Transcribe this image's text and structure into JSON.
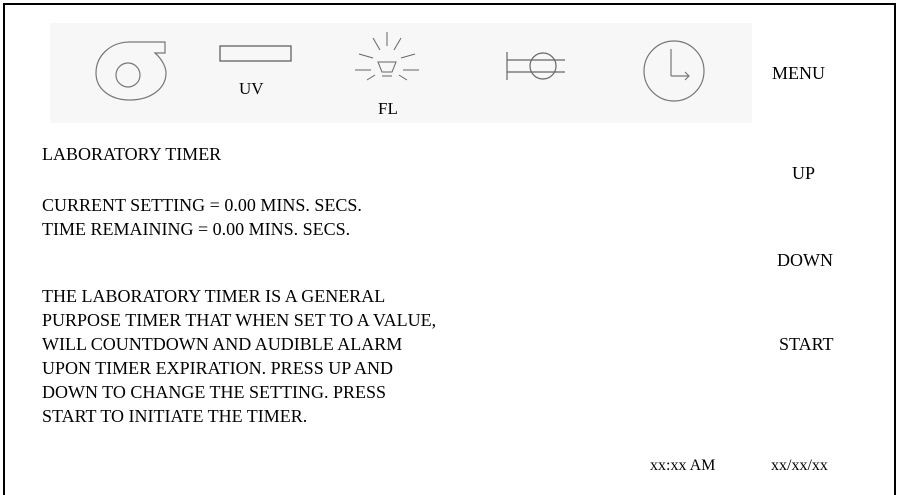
{
  "toolbar": {
    "icons": [
      {
        "name": "blower-fan-icon"
      },
      {
        "name": "uv-lamp-icon",
        "label": "UV"
      },
      {
        "name": "fluorescent-light-icon",
        "label": "FL"
      },
      {
        "name": "outlet-valve-icon"
      },
      {
        "name": "clock-timer-icon"
      }
    ],
    "menu_label": "MENU"
  },
  "screen": {
    "title": "LABORATORY TIMER",
    "current_setting": "CURRENT SETTING = 0.00 MINS. SECS.",
    "time_remaining": "TIME REMAINING = 0.00 MINS. SECS.",
    "description_lines": [
      "THE LABORATORY TIMER IS A GENERAL",
      "PURPOSE TIMER THAT WHEN SET TO A VALUE,",
      "WILL COUNTDOWN AND AUDIBLE ALARM",
      "UPON TIMER EXPIRATION.  PRESS UP AND",
      "DOWN TO CHANGE THE SETTING.  PRESS",
      "START TO INITIATE THE TIMER."
    ]
  },
  "controls": {
    "up_label": "UP",
    "down_label": "DOWN",
    "start_label": "START"
  },
  "status": {
    "time": "xx:xx AM",
    "date": "xx/xx/xx"
  }
}
